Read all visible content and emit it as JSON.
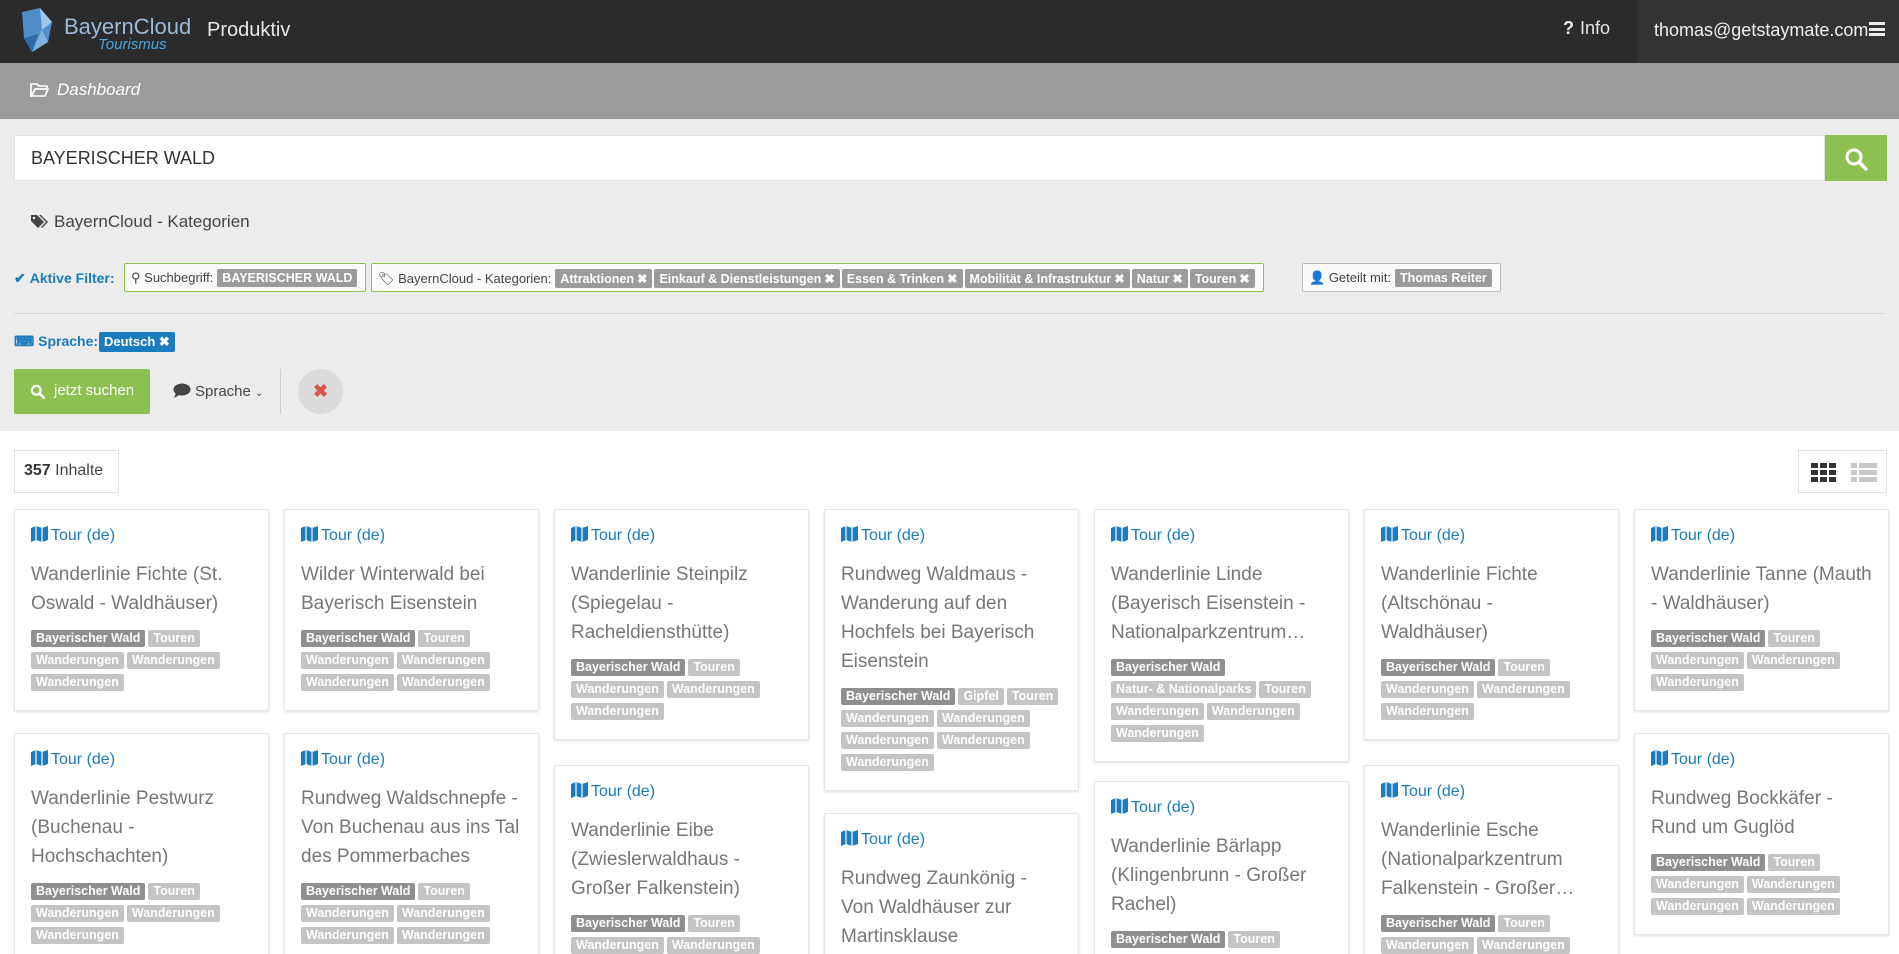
{
  "topbar": {
    "logo_line1": "BayernCloud",
    "logo_line2": "Tourismus",
    "environment": "Produktiv",
    "info_label": "Info",
    "user_email": "thomas@getstaymate.com"
  },
  "breadcrumb": {
    "label": "Dashboard"
  },
  "search": {
    "value": "BAYERISCHER WALD"
  },
  "categories_link": "BayernCloud - Kategorien",
  "active_filters": {
    "label": "Aktive Filter:",
    "search_group": {
      "label": "Suchbegriff:",
      "chips": [
        "BAYERISCHER WALD"
      ]
    },
    "category_group": {
      "label": "BayernCloud - Kategorien:",
      "chips": [
        "Attraktionen",
        "Einkauf & Dienstleistungen",
        "Essen & Trinken",
        "Mobilität & Infrastruktur",
        "Natur",
        "Touren"
      ]
    },
    "shared_group": {
      "label": "Geteilt mit:",
      "chips": [
        "Thomas Reiter"
      ]
    }
  },
  "language": {
    "label": "Sprache:",
    "chip": "Deutsch"
  },
  "buttons": {
    "search_now": "jetzt suchen",
    "language_dropdown": "Sprache",
    "reset": "✖"
  },
  "results": {
    "count": "357",
    "count_label": "Inhalte"
  },
  "colors": {
    "accent": "#1a7bbf",
    "success": "#8cc152",
    "topbar": "#2b2b2b"
  },
  "cards": [
    {
      "type": "Tour (de)",
      "title": "Wanderlinie Fichte (St. Oswald - Waldhäuser)",
      "tags": [
        "Bayerischer Wald",
        "Touren",
        "Wanderungen",
        "Wanderungen",
        "Wanderungen"
      ]
    },
    {
      "type": "Tour (de)",
      "title": "Wilder Winterwald bei Bayerisch Eisenstein",
      "tags": [
        "Bayerischer Wald",
        "Touren",
        "Wanderungen",
        "Wanderungen",
        "Wanderungen",
        "Wanderungen"
      ]
    },
    {
      "type": "Tour (de)",
      "title": "Wanderlinie Steinpilz (Spiegelau - Racheldiensthütte)",
      "tags": [
        "Bayerischer Wald",
        "Touren",
        "Wanderungen",
        "Wanderungen",
        "Wanderungen"
      ]
    },
    {
      "type": "Tour (de)",
      "title": "Rundweg Waldmaus - Wanderung auf den Hochfels bei Bayerisch Eisenstein",
      "tags": [
        "Bayerischer Wald",
        "Gipfel",
        "Touren",
        "Wanderungen",
        "Wanderungen",
        "Wanderungen",
        "Wanderungen",
        "Wanderungen"
      ]
    },
    {
      "type": "Tour (de)",
      "title": "Wanderlinie Linde (Bayerisch Eisenstein - Nationalparkzentrum…",
      "tags": [
        "Bayerischer Wald",
        "Natur- & Nationalparks",
        "Touren",
        "Wanderungen",
        "Wanderungen",
        "Wanderungen"
      ]
    },
    {
      "type": "Tour (de)",
      "title": "Wanderlinie Fichte (Altschönau - Waldhäuser)",
      "tags": [
        "Bayerischer Wald",
        "Touren",
        "Wanderungen",
        "Wanderungen",
        "Wanderungen"
      ]
    },
    {
      "type": "Tour (de)",
      "title": "Wanderlinie Tanne (Mauth - Waldhäuser)",
      "tags": [
        "Bayerischer Wald",
        "Touren",
        "Wanderungen",
        "Wanderungen",
        "Wanderungen"
      ]
    },
    {
      "type": "Tour (de)",
      "title": "Wanderlinie Pestwurz (Buchenau - Hochschachten)",
      "tags": [
        "Bayerischer Wald",
        "Touren",
        "Wanderungen",
        "Wanderungen",
        "Wanderungen"
      ]
    },
    {
      "type": "Tour (de)",
      "title": "Rundweg Waldschnepfe - Von Buchenau aus ins Tal des Pommerbaches",
      "tags": [
        "Bayerischer Wald",
        "Touren",
        "Wanderungen",
        "Wanderungen",
        "Wanderungen",
        "Wanderungen"
      ]
    },
    {
      "type": "Tour (de)",
      "title": "Wanderlinie Eibe (Zwieslerwaldhaus - Großer Falkenstein)",
      "tags": [
        "Bayerischer Wald",
        "Touren",
        "Wanderungen",
        "Wanderungen"
      ]
    },
    {
      "type": "Tour (de)",
      "title": "Rundweg Zaunkönig - Von Waldhäuser zur Martinsklause",
      "tags": []
    },
    {
      "type": "Tour (de)",
      "title": "Wanderlinie Bärlapp (Klingenbrunn - Großer Rachel)",
      "tags": [
        "Bayerischer Wald",
        "Touren"
      ]
    },
    {
      "type": "Tour (de)",
      "title": "Wanderlinie Esche (Nationalparkzentrum Falkenstein - Großer…",
      "tags": [
        "Bayerischer Wald",
        "Touren",
        "Wanderungen",
        "Wanderungen"
      ]
    },
    {
      "type": "Tour (de)",
      "title": "Rundweg Bockkäfer - Rund um Guglöd",
      "tags": [
        "Bayerischer Wald",
        "Touren",
        "Wanderungen",
        "Wanderungen",
        "Wanderungen",
        "Wanderungen"
      ]
    }
  ]
}
